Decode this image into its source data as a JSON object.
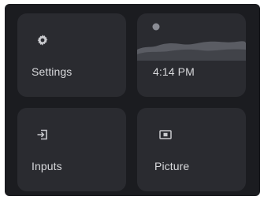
{
  "tiles": {
    "settings": {
      "label": "Settings",
      "icon": "gear-icon"
    },
    "clock": {
      "time": "4:14 PM",
      "icon": "moon-icon"
    },
    "inputs": {
      "label": "Inputs",
      "icon": "input-icon"
    },
    "picture": {
      "label": "Picture",
      "icon": "picture-icon"
    }
  },
  "colors": {
    "background": "#1b1c20",
    "tile": "#2a2b30",
    "text": "#d8d9dc",
    "icon": "#c9cace"
  }
}
